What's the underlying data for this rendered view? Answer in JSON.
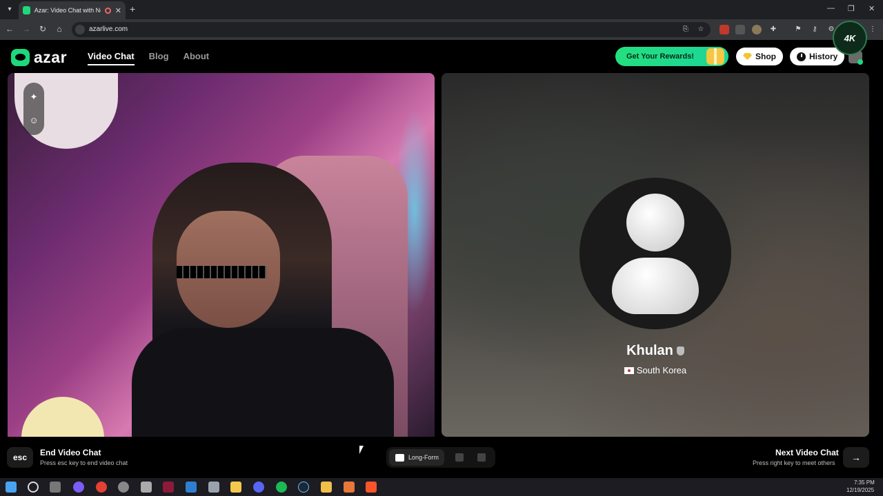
{
  "browser": {
    "tab_title": "Azar: Video Chat with New",
    "url": "azarlive.com"
  },
  "site": {
    "logo_text": "azar",
    "nav": [
      "Video Chat",
      "Blog",
      "About"
    ],
    "rewards_label": "Get Your Rewards!",
    "shop_label": "Shop",
    "history_label": "History",
    "badge_text": "4K"
  },
  "peer": {
    "name": "Khulan",
    "country": "South Korea"
  },
  "controls": {
    "esc_key": "esc",
    "end_title": "End Video Chat",
    "end_sub": "Press esc key to end video chat",
    "layout_label": "Long-Form",
    "next_title": "Next Video Chat",
    "next_sub": "Press right key to meet others",
    "next_arrow": "→"
  },
  "taskbar": {
    "time": "7:35 PM",
    "date": "12/19/2025"
  },
  "colors": {
    "accent": "#1ed87a",
    "rewards_gradient_start": "#23e07e",
    "rewards_gradient_end": "#1bd49a"
  }
}
